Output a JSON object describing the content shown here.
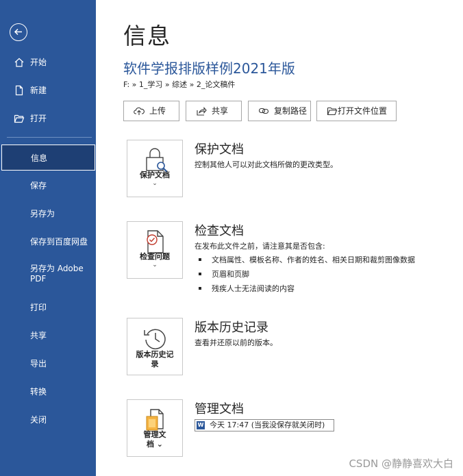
{
  "sidebar": {
    "items": [
      {
        "label": "开始"
      },
      {
        "label": "新建"
      },
      {
        "label": "打开"
      },
      {
        "label": "信息"
      },
      {
        "label": "保存"
      },
      {
        "label": "另存为"
      },
      {
        "label": "保存到百度网盘"
      },
      {
        "label": "另存为 Adobe PDF"
      },
      {
        "label": "打印"
      },
      {
        "label": "共享"
      },
      {
        "label": "导出"
      },
      {
        "label": "转换"
      },
      {
        "label": "关闭"
      }
    ],
    "active_index": 3,
    "colors": {
      "background": "#2b579a",
      "active_background": "#1e3f74"
    }
  },
  "main": {
    "page_title": "信息",
    "doc_title": "软件学报排版样例2021年版",
    "breadcrumb": "F: » 1_学习 » 综述 » 2_论文稿件",
    "actions": [
      {
        "label": "上传",
        "icon": "upload-icon"
      },
      {
        "label": "共享",
        "icon": "share-icon"
      },
      {
        "label": "复制路径",
        "icon": "link-icon"
      },
      {
        "label": "打开文件位置",
        "icon": "folder-icon"
      }
    ],
    "sections": {
      "protect": {
        "button_label": "保护文档",
        "title": "保护文档",
        "desc": "控制其他人可以对此文档所做的更改类型。"
      },
      "inspect": {
        "button_label": "检查问题",
        "title": "检查文档",
        "desc": "在发布此文件之前，请注意其是否包含:",
        "bullets": [
          "文档属性、模板名称、作者的姓名、相关日期和裁剪图像数据",
          "页眉和页脚",
          "残疾人士无法阅读的内容"
        ]
      },
      "history": {
        "button_label_line1": "版本历史记",
        "button_label_line2": "录",
        "title": "版本历史记录",
        "desc": "查看并还原以前的版本。"
      },
      "manage": {
        "button_label_line1": "管理文",
        "button_label_line2": "档",
        "title": "管理文档",
        "version_entry": "今天 17:47 (当我没保存就关闭时)"
      }
    }
  },
  "watermark": "CSDN @静静喜欢大白"
}
